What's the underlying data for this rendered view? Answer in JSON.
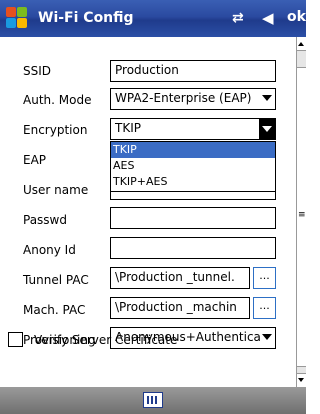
{
  "window": {
    "title": "Wi-Fi Config",
    "ok_label": "ok"
  },
  "form": {
    "ssid": {
      "label": "SSID",
      "value": "Production"
    },
    "auth_mode": {
      "label": "Auth. Mode",
      "value": "WPA2-Enterprise (EAP)"
    },
    "encryption": {
      "label": "Encryption",
      "value": "TKIP",
      "options": [
        "TKIP",
        "AES",
        "TKIP+AES"
      ],
      "selected": "TKIP"
    },
    "eap": {
      "label": "EAP"
    },
    "user_name": {
      "label": "User name",
      "value": ""
    },
    "passwd": {
      "label": "Passwd",
      "value": ""
    },
    "anony_id": {
      "label": "Anony Id",
      "value": ""
    },
    "tunnel_pac": {
      "label": "Tunnel PAC",
      "value": "\\Production _tunnel.",
      "browse_label": "..."
    },
    "mach_pac": {
      "label": "Mach. PAC",
      "value": "\\Production _machin",
      "browse_label": "..."
    },
    "provisioning": {
      "label": "Provisioning",
      "value": "Anonymous+Authentica"
    },
    "verify_cert": {
      "label": "Verify Server Certificate",
      "checked": false
    }
  },
  "icons": {
    "start": "windows-logo-icon",
    "connectivity": "connectivity-icon",
    "volume": "volume-icon",
    "keyboard": "keyboard-icon"
  }
}
